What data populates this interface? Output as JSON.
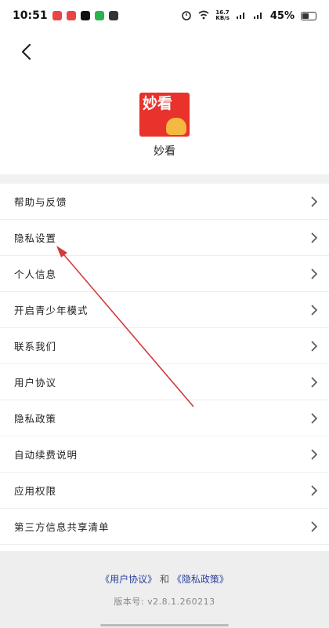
{
  "status_bar": {
    "time": "10:51",
    "network_speed": "16.7\nKB/s",
    "battery": "45%",
    "app_icon_colors": [
      "#e84545",
      "#e84545",
      "#111111",
      "#2bb24c",
      "#333333"
    ]
  },
  "header": {
    "back_icon": "chevron-left-icon"
  },
  "app": {
    "name": "妙看",
    "logo_text": "妙看",
    "brand_color": "#e8322b"
  },
  "menu": {
    "items": [
      {
        "label": "帮助与反馈"
      },
      {
        "label": "隐私设置"
      },
      {
        "label": "个人信息"
      },
      {
        "label": "开启青少年模式"
      },
      {
        "label": "联系我们"
      },
      {
        "label": "用户协议"
      },
      {
        "label": "隐私政策"
      },
      {
        "label": "自动续费说明"
      },
      {
        "label": "应用权限"
      },
      {
        "label": "第三方信息共享清单"
      }
    ]
  },
  "footer": {
    "user_agreement_link": "《用户协议》",
    "and_text": "和",
    "privacy_policy_link": "《隐私政策》",
    "version": "版本号: v2.8.1.260213"
  },
  "annotation": {
    "color": "#d23a3a"
  }
}
